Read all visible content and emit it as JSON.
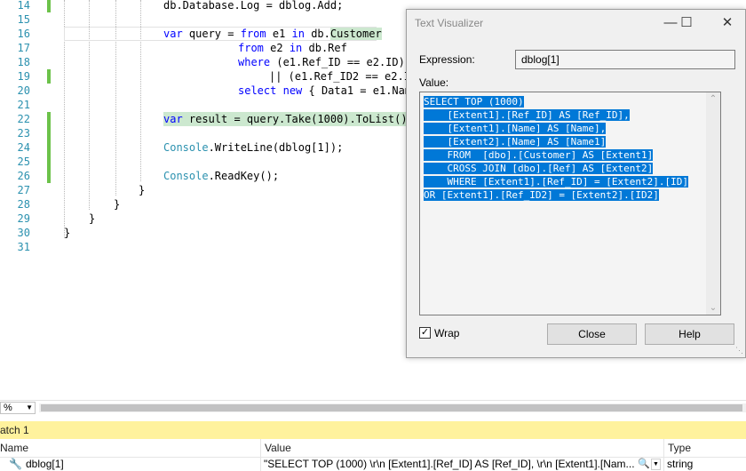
{
  "editor": {
    "lines": [
      {
        "num": "14",
        "code": "db.Database.Log = dblog.Add;"
      },
      {
        "num": "15",
        "code": ""
      },
      {
        "num": "16",
        "code": "var query = from e1 in db.Customer"
      },
      {
        "num": "17",
        "code": "from e2 in db.Ref"
      },
      {
        "num": "18",
        "code": "where (e1.Ref_ID == e2.ID)"
      },
      {
        "num": "19",
        "code": "|| (e1.Ref_ID2 == e2.I"
      },
      {
        "num": "20",
        "code": "select new { Data1 = e1.Nam"
      },
      {
        "num": "21",
        "code": ""
      },
      {
        "num": "22",
        "code": "var result = query.Take(1000).ToList();"
      },
      {
        "num": "23",
        "code": ""
      },
      {
        "num": "24",
        "code": "Console.WriteLine(dblog[1]);"
      },
      {
        "num": "25",
        "code": ""
      },
      {
        "num": "26",
        "code": "Console.ReadKey();"
      },
      {
        "num": "27",
        "code": "}"
      },
      {
        "num": "28",
        "code": "}"
      },
      {
        "num": "29",
        "code": "}"
      },
      {
        "num": "30",
        "code": "}"
      },
      {
        "num": "31",
        "code": ""
      }
    ]
  },
  "dialog": {
    "title": "Text Visualizer",
    "minimize_glyph": "—",
    "maximize_glyph": "☐",
    "close_glyph": "✕",
    "expression_label": "Expression:",
    "expression_value": "dblog[1]",
    "value_label": "Value:",
    "value_lines": [
      "SELECT TOP (1000)",
      "    [Extent1].[Ref_ID] AS [Ref_ID],",
      "    [Extent1].[Name] AS [Name],",
      "    [Extent2].[Name] AS [Name1]",
      "    FROM  [dbo].[Customer] AS [Extent1]",
      "    CROSS JOIN [dbo].[Ref] AS [Extent2]",
      "    WHERE [Extent1].[Ref_ID] = [Extent2].[ID]",
      "OR [Extent1].[Ref_ID2] = [Extent2].[ID2]"
    ],
    "wrap_label": "Wrap",
    "wrap_checked": true,
    "close_button": "Close",
    "help_button": "Help"
  },
  "zoom": {
    "value": "%"
  },
  "watch": {
    "title": "atch 1",
    "columns": {
      "name": "Name",
      "value": "Value",
      "type": "Type"
    },
    "rows": [
      {
        "name": "dblog[1]",
        "value": "\"SELECT TOP (1000) \\r\\n    [Extent1].[Ref_ID] AS [Ref_ID], \\r\\n    [Extent1].[Nam...",
        "type": "string"
      }
    ]
  },
  "colors": {
    "keyword": "#0000ff",
    "type": "#2b91af",
    "line_number": "#2b91af",
    "selection": "#0078d7",
    "change_margin": "#6cc24a",
    "watch_title_bg": "#fff29d"
  }
}
